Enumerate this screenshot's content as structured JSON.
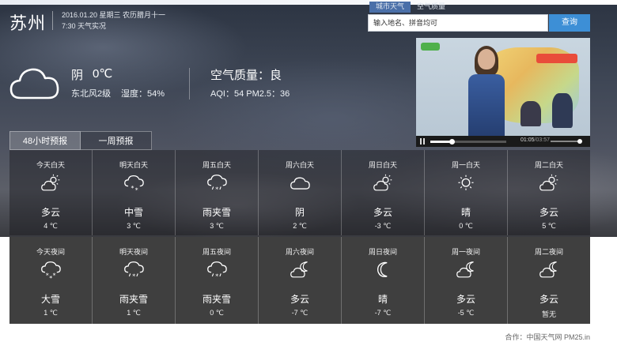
{
  "header": {
    "city": "苏州",
    "date_line": "2016.01.20 星期三 农历腊月十一",
    "time_line": "7:30 天气实况"
  },
  "search": {
    "tabs": [
      "城市天气",
      "空气质量"
    ],
    "placeholder": "输入地名、拼音均可",
    "button_label": "查询"
  },
  "current": {
    "icon": "cloud-icon",
    "condition": "阴",
    "temperature": "0℃",
    "wind": "东北风2级",
    "humidity": "湿度：54%",
    "air_quality_title": "空气质量：良",
    "aqi_line": "AQI：54  PM2.5：36"
  },
  "video": {
    "time_current": "01:05",
    "time_total": "/03:57",
    "progress": 0.28
  },
  "tabs": [
    {
      "label": "48小时预报",
      "active": true
    },
    {
      "label": "一周预报",
      "active": false
    }
  ],
  "day_forecast": [
    {
      "label": "今天白天",
      "icon": "partly-cloudy-day-icon",
      "condition": "多云",
      "temp": "4 ℃"
    },
    {
      "label": "明天白天",
      "icon": "snow-icon",
      "condition": "中雪",
      "temp": "3 ℃"
    },
    {
      "label": "周五白天",
      "icon": "sleet-icon",
      "condition": "雨夹雪",
      "temp": "3 ℃"
    },
    {
      "label": "周六白天",
      "icon": "cloud-icon",
      "condition": "阴",
      "temp": "2 ℃"
    },
    {
      "label": "周日白天",
      "icon": "partly-cloudy-day-icon",
      "condition": "多云",
      "temp": "-3 ℃"
    },
    {
      "label": "周一白天",
      "icon": "sun-icon",
      "condition": "晴",
      "temp": "0 ℃"
    },
    {
      "label": "周二白天",
      "icon": "partly-cloudy-day-icon",
      "condition": "多云",
      "temp": "5 ℃"
    }
  ],
  "night_forecast": [
    {
      "label": "今天夜间",
      "icon": "heavy-snow-icon",
      "condition": "大雪",
      "temp": "1 ℃"
    },
    {
      "label": "明天夜间",
      "icon": "sleet-icon",
      "condition": "雨夹雪",
      "temp": "1 ℃"
    },
    {
      "label": "周五夜间",
      "icon": "sleet-icon",
      "condition": "雨夹雪",
      "temp": "0 ℃"
    },
    {
      "label": "周六夜间",
      "icon": "partly-cloudy-night-icon",
      "condition": "多云",
      "temp": "-7 ℃"
    },
    {
      "label": "周日夜间",
      "icon": "moon-icon",
      "condition": "晴",
      "temp": "-7 ℃"
    },
    {
      "label": "周一夜间",
      "icon": "partly-cloudy-night-icon",
      "condition": "多云",
      "temp": "-5 ℃"
    },
    {
      "label": "周二夜间",
      "icon": "partly-cloudy-night-icon",
      "condition": "多云",
      "temp": "暂无"
    }
  ],
  "credit": "合作：中国天气网 PM25.in"
}
